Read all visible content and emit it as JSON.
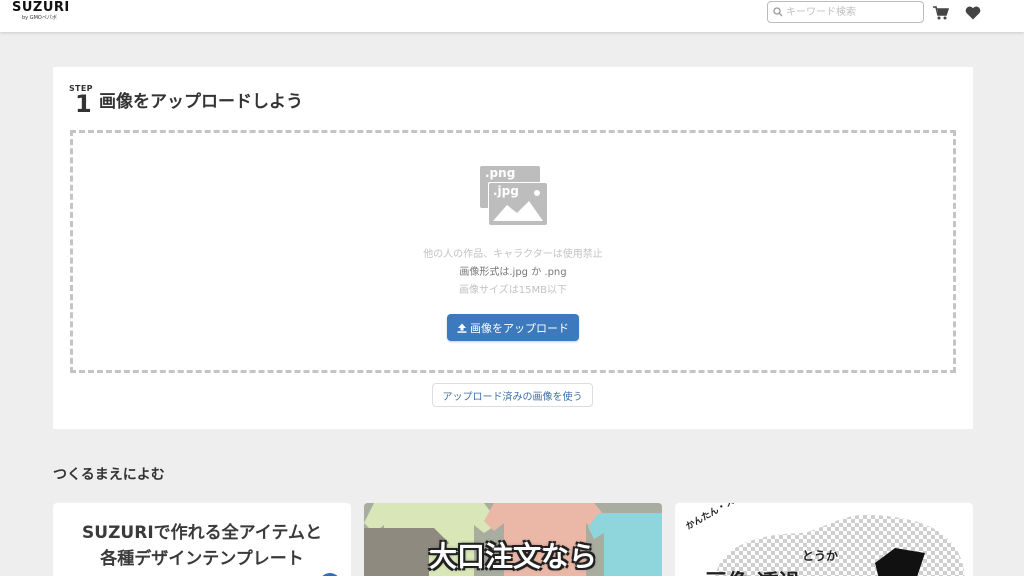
{
  "header": {
    "logo": "SUZURI",
    "logo_sub": "by GMOペパボ",
    "search_placeholder": "キーワード検索",
    "cart_icon": "cart-icon",
    "heart_icon": "heart-icon"
  },
  "step": {
    "label": "STEP",
    "number": "1",
    "title": "画像をアップロードしよう",
    "dropzone": {
      "icon": "image-file-icon",
      "icon_labels": [
        ".png",
        ".jpg"
      ],
      "notice_1": "他の人の作品、キャラクターは使用禁止",
      "notice_2": "画像形式は.jpg か .png",
      "notice_3": "画像サイズは15MB以下"
    },
    "upload_button": "画像をアップロード",
    "used_images_button": "アップロード済みの画像を使う"
  },
  "guide": {
    "title": "つくるまえによむ",
    "banners": [
      {
        "line1": "SUZURIで作れる全アイテムと",
        "line2": "各種デザインテンプレート"
      },
      {
        "text": "大口注文なら"
      },
      {
        "small": "かんたん・スケスケ!!",
        "mid": "とうか",
        "big": "画像 透過"
      }
    ]
  },
  "colors": {
    "accent": "#3d79bd",
    "page_bg": "#eeeeee",
    "card_bg": "#ffffff"
  }
}
